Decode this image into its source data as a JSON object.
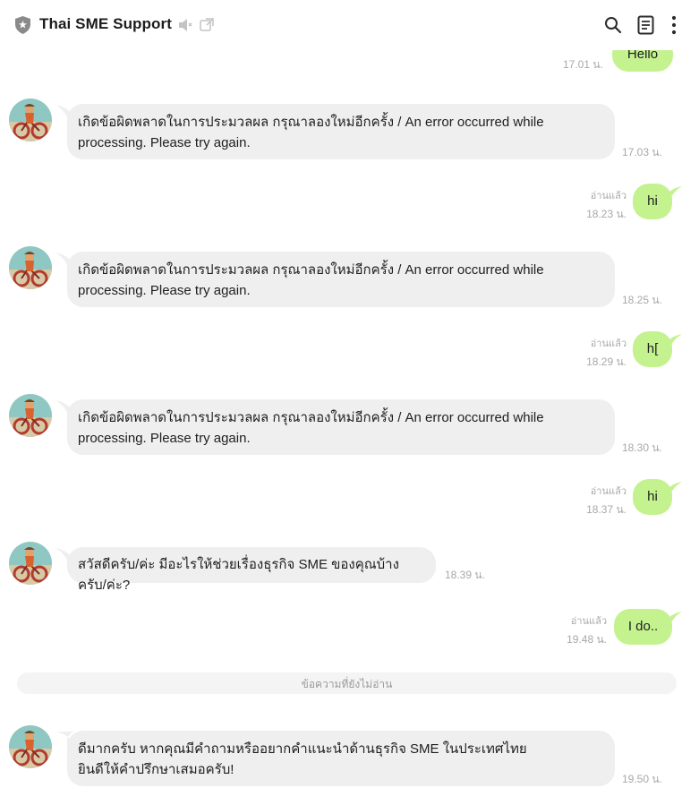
{
  "header": {
    "title": "Thai SME Support",
    "icons": [
      "shield-icon",
      "mute-speaker-icon",
      "external-window-icon",
      "search-icon",
      "notes-icon",
      "more-vert-icon"
    ]
  },
  "colors": {
    "outgoing": "#c4f28f",
    "incoming": "#efefef",
    "meta": "#a8a8a8"
  },
  "messages": {
    "m0": {
      "text": "Hello",
      "time": "17.01 น."
    },
    "m1": {
      "line1": "เกิดข้อผิดพลาดในการประมวลผล กรุณาลองใหม่อีกครั้ง / An error occurred while",
      "line2": "processing. Please try again.",
      "time": "17.03 น."
    },
    "m2": {
      "text": "hi",
      "read": "อ่านแล้ว",
      "time": "18.23 น."
    },
    "m3": {
      "line1": "เกิดข้อผิดพลาดในการประมวลผล กรุณาลองใหม่อีกครั้ง / An error occurred while",
      "line2": "processing. Please try again.",
      "time": "18.25 น."
    },
    "m4": {
      "text": "h[",
      "read": "อ่านแล้ว",
      "time": "18.29 น."
    },
    "m5": {
      "line1": "เกิดข้อผิดพลาดในการประมวลผล กรุณาลองใหม่อีกครั้ง / An error occurred while",
      "line2": "processing. Please try again.",
      "time": "18.30 น."
    },
    "m6": {
      "text": "hi",
      "read": "อ่านแล้ว",
      "time": "18.37 น."
    },
    "m7": {
      "text": "สวัสดีครับ/ค่ะ มีอะไรให้ช่วยเรื่องธุรกิจ SME ของคุณบ้างครับ/ค่ะ?",
      "time": "18.39 น."
    },
    "m8": {
      "text": "I do..",
      "read": "อ่านแล้ว",
      "time": "19.48 น."
    },
    "unread_divider": "ข้อความที่ยังไม่อ่าน",
    "m9": {
      "line1": "ดีมากครับ หากคุณมีคำถามหรืออยากคำแนะนำด้านธุรกิจ SME ในประเทศไทย",
      "line2": "ยินดีให้คำปรึกษาเสมอครับ!",
      "time": "19.50 น."
    }
  }
}
